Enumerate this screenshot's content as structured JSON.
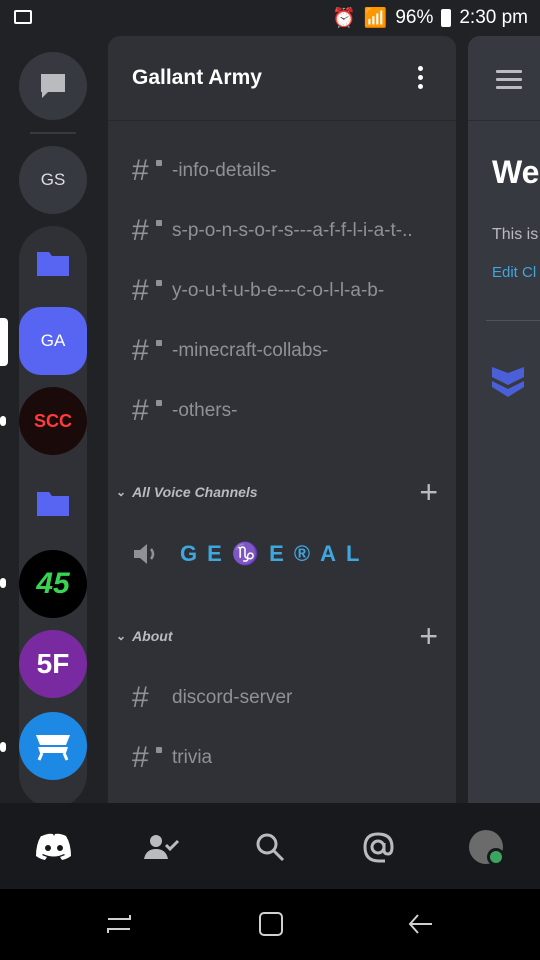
{
  "status_bar": {
    "battery": "96%",
    "time": "2:30 pm"
  },
  "servers": {
    "gs_label": "GS",
    "ga_label": "GA",
    "scc_label": "SCC",
    "s45_label": "45",
    "s5f_label": "5F"
  },
  "guild": {
    "name": "Gallant Army"
  },
  "channels": {
    "text_top": [
      {
        "name": "-info-details-"
      },
      {
        "name": "s-p-o-n-s-o-r-s---a-f-f-l-i-a-t-.."
      },
      {
        "name": "y-o-u-t-u-b-e---c-o-l-l-a-b-"
      },
      {
        "name": "-minecraft-collabs-"
      },
      {
        "name": "-others-"
      }
    ],
    "voice_category": "All Voice Channels",
    "voice_channel": "GE♑E®AL",
    "about_category": "About",
    "text_about": [
      {
        "name": "discord-server"
      },
      {
        "name": "trivia"
      }
    ]
  },
  "main": {
    "welcome": "We",
    "this_is": "This is",
    "edit": "Edit Cl"
  },
  "colors": {
    "blurple": "#5865f2",
    "accent_blue": "#3ea7e0",
    "online_green": "#3ba55d"
  },
  "icons": [
    "dm-icon",
    "folder-icon",
    "discord-home-icon",
    "friends-icon",
    "search-icon",
    "mentions-icon",
    "profile-avatar",
    "hamburger-icon",
    "kebab-menu-icon"
  ]
}
